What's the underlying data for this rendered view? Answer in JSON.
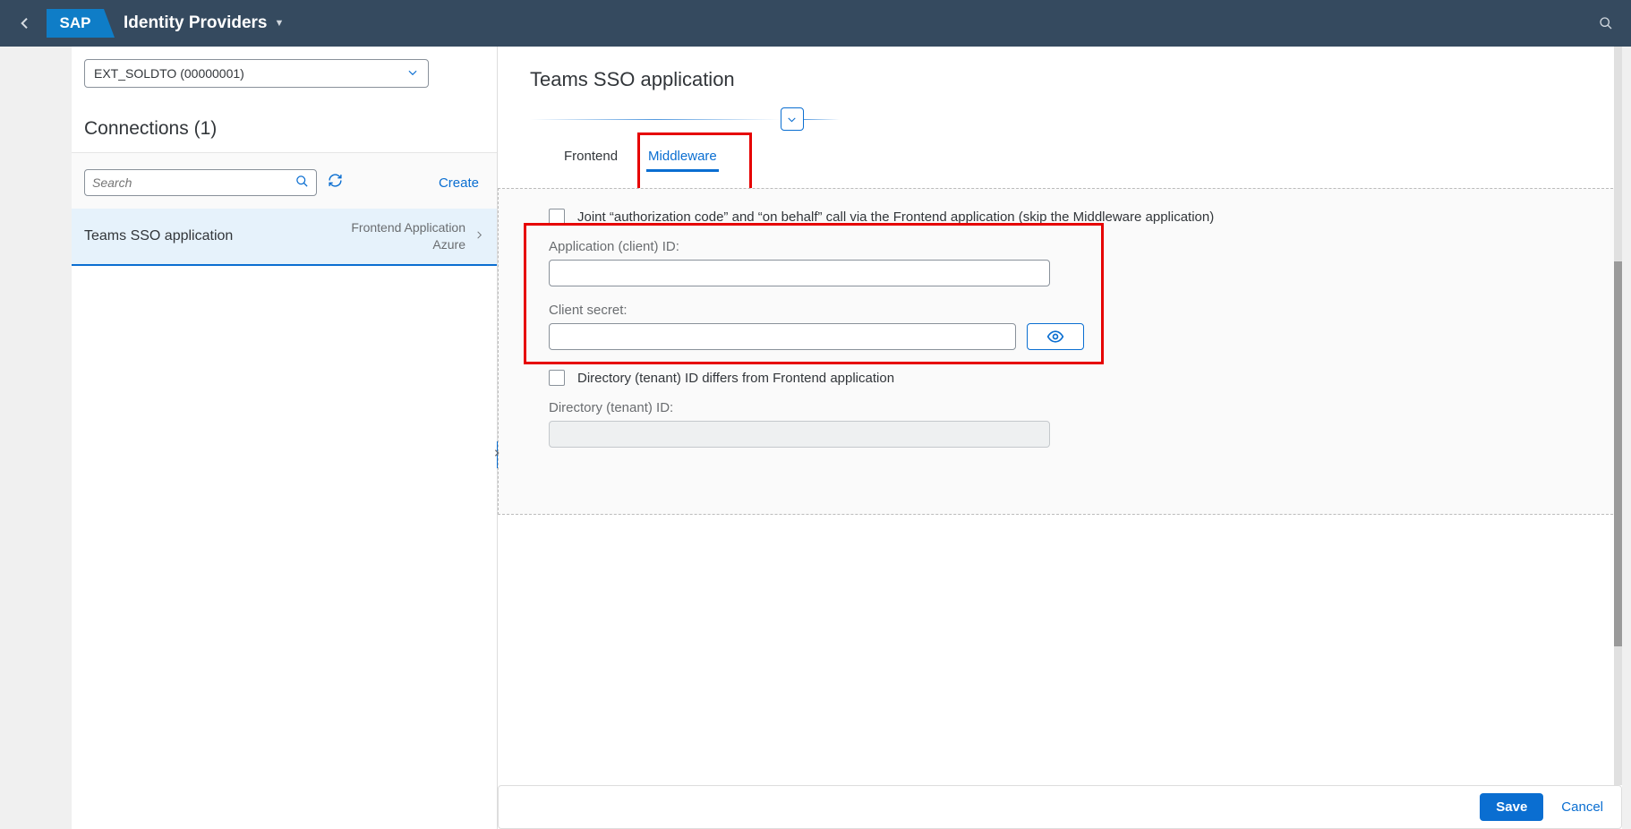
{
  "header": {
    "logo_text": "SAP",
    "title": "Identity Providers"
  },
  "left": {
    "ext_select": "EXT_SOLDTO (00000001)",
    "heading": "Connections (1)",
    "search_placeholder": "Search",
    "create_label": "Create",
    "item": {
      "main": "Teams SSO application",
      "line1": "Frontend Application",
      "line2": "Azure"
    }
  },
  "right": {
    "title": "Teams SSO application",
    "tabs": {
      "frontend": "Frontend",
      "middleware": "Middleware"
    },
    "joint_label": "Joint “authorization code” and “on behalf” call via the Frontend application (skip the Middleware application)",
    "app_id_label": "Application (client) ID:",
    "app_id_value": "",
    "secret_label": "Client secret:",
    "secret_value": "",
    "tenant_differs_label": "Directory (tenant) ID differs from Frontend application",
    "tenant_id_label": "Directory (tenant) ID:",
    "tenant_id_value": ""
  },
  "footer": {
    "save": "Save",
    "cancel": "Cancel"
  }
}
